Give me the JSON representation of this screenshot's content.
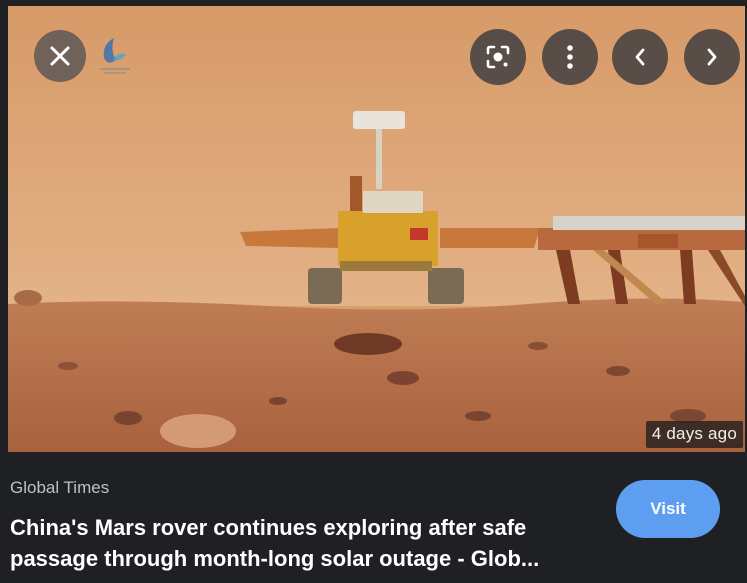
{
  "viewer": {
    "close_icon": "close-icon",
    "lens_icon": "google-lens-icon",
    "more_icon": "more-vert-icon",
    "prev_icon": "chevron-left-icon",
    "next_icon": "chevron-right-icon",
    "source_logo_icon": "global-times-logo-icon",
    "time_ago": "4 days ago"
  },
  "result": {
    "source": "Global Times",
    "title": "China's Mars rover continues exploring after safe passage through month-long solar outage - Glob...",
    "visit_label": "Visit"
  },
  "colors": {
    "background": "#1f2023",
    "visit_button": "#5e9ef0",
    "sky": "#d9a06a",
    "ground": "#b9714a"
  }
}
